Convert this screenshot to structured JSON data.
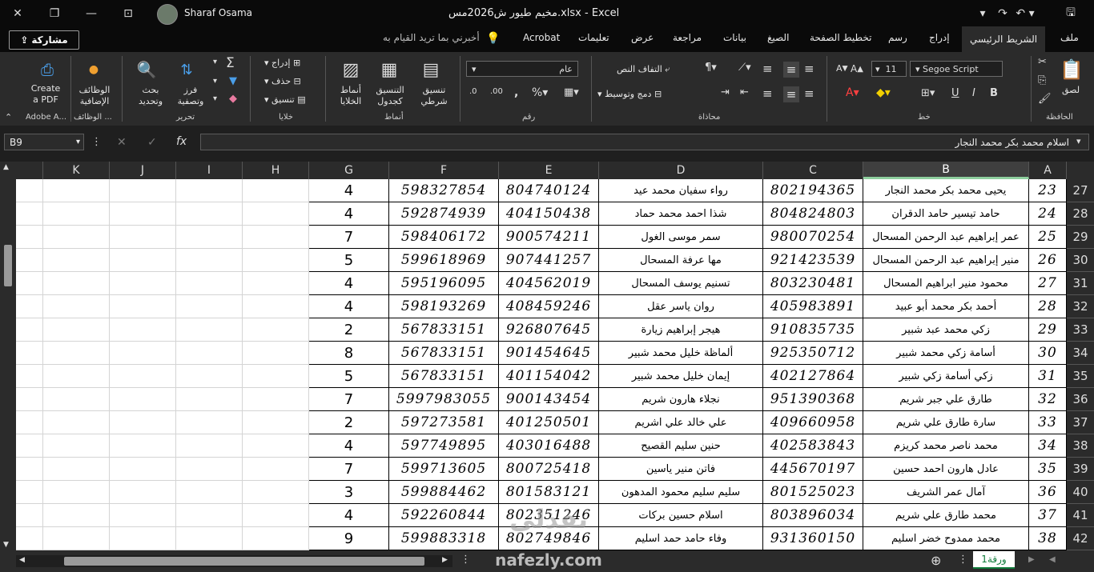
{
  "titlebar": {
    "user_name": "Sharaf Osama",
    "doc_title": "مخيم طيور ش2026مس.xlsx  -  Excel"
  },
  "share_label": "مشاركة",
  "tabs": [
    "ملف",
    "الشريط الرئيسي",
    "إدراج",
    "رسم",
    "تخطيط الصفحة",
    "الصيغ",
    "بيانات",
    "مراجعة",
    "عرض",
    "تعليمات",
    "Acrobat"
  ],
  "tell_me": "أخبرني بما تريد القيام به",
  "ribbon": {
    "clipboard": {
      "label": "الحافظة",
      "paste": "لصق"
    },
    "font": {
      "label": "خط",
      "font_name": "Segoe Script",
      "font_size": "11"
    },
    "alignment": {
      "label": "محاذاة",
      "wrap": "التفاف النص",
      "merge": "دمج وتوسيط"
    },
    "number": {
      "label": "رقم",
      "format": "عام"
    },
    "styles": {
      "label": "أنماط",
      "conditional": "تنسيق شرطي",
      "as_table": "التنسيق كجدول",
      "cell_styles": "أنماط الخلايا"
    },
    "cells": {
      "label": "خلايا",
      "insert": "إدراج",
      "delete": "حذف",
      "format": "تنسيق"
    },
    "editing": {
      "label": "تحرير",
      "sort": "فرز وتصفية",
      "find": "بحث وتحديد"
    },
    "addins": {
      "label": "الوظائف ...",
      "button": "الوظائف الإضافية"
    },
    "adobe": {
      "label": "Adobe A...",
      "button": "Create a PDF"
    }
  },
  "formula_bar": {
    "name_box": "B9",
    "content": "اسلام محمد بكر محمد النجار"
  },
  "columns": [
    "A",
    "B",
    "C",
    "D",
    "E",
    "F",
    "G",
    "H",
    "I",
    "J",
    "K"
  ],
  "rows": [
    {
      "row": "27",
      "a": "23",
      "b": "يحيى محمد بكر محمد النجار",
      "c": "802194365",
      "d": "رواء سفيان محمد عيد",
      "e": "804740124",
      "f": "598327854",
      "g": "4"
    },
    {
      "row": "28",
      "a": "24",
      "b": "حامد تيسير حامد الدقران",
      "c": "804824803",
      "d": "شذا احمد محمد حماد",
      "e": "404150438",
      "f": "592874939",
      "g": "4"
    },
    {
      "row": "29",
      "a": "25",
      "b": "عمر إبراهيم عبد الرحمن المسحال",
      "c": "980070254",
      "d": "سمر موسى الغول",
      "e": "900574211",
      "f": "598406172",
      "g": "7"
    },
    {
      "row": "30",
      "a": "26",
      "b": "منير إبراهيم عبد الرحمن المسحال",
      "c": "921423539",
      "d": "مها عرفة المسحال",
      "e": "907441257",
      "f": "599618969",
      "g": "5"
    },
    {
      "row": "31",
      "a": "27",
      "b": "محمود منير ابراهيم المسحال",
      "c": "803230481",
      "d": "تسنيم يوسف المسحال",
      "e": "404562019",
      "f": "595196095",
      "g": "4"
    },
    {
      "row": "32",
      "a": "28",
      "b": "أحمد بكر محمد أبو عبيد",
      "c": "405983891",
      "d": "روان ياسر عقل",
      "e": "408459246",
      "f": "598193269",
      "g": "4"
    },
    {
      "row": "33",
      "a": "29",
      "b": "زكي محمد عبد شبير",
      "c": "910835735",
      "d": "هيجر إبراهيم زيارة",
      "e": "926807645",
      "f": "567833151",
      "g": "2"
    },
    {
      "row": "34",
      "a": "30",
      "b": "أسامة زكي محمد شبير",
      "c": "925350712",
      "d": "ألماظة خليل محمد شبير",
      "e": "901454645",
      "f": "567833151",
      "g": "8"
    },
    {
      "row": "35",
      "a": "31",
      "b": "زكي أسامة زكي شبير",
      "c": "402127864",
      "d": "إيمان خليل محمد شبير",
      "e": "401154042",
      "f": "567833151",
      "g": "5"
    },
    {
      "row": "36",
      "a": "32",
      "b": "طارق علي جبر شريم",
      "c": "951390368",
      "d": "نجلاء هارون شريم",
      "e": "900143454",
      "f": "5997983055",
      "g": "7"
    },
    {
      "row": "37",
      "a": "33",
      "b": "سارة طارق علي شريم",
      "c": "409660958",
      "d": "علي خالد علي اشريم",
      "e": "401250501",
      "f": "597273581",
      "g": "2"
    },
    {
      "row": "38",
      "a": "34",
      "b": "محمد ناصر محمد كريزم",
      "c": "402583843",
      "d": "حنين سليم القصيح",
      "e": "403016488",
      "f": "597749895",
      "g": "4"
    },
    {
      "row": "39",
      "a": "35",
      "b": "عادل هارون احمد حسين",
      "c": "445670197",
      "d": "فاتن منير ياسين",
      "e": "800725418",
      "f": "599713605",
      "g": "7"
    },
    {
      "row": "40",
      "a": "36",
      "b": "آمال عمر الشريف",
      "c": "801525023",
      "d": "سليم سليم محمود المدهون",
      "e": "801583121",
      "f": "599884462",
      "g": "3"
    },
    {
      "row": "41",
      "a": "37",
      "b": "محمد طارق علي شريم",
      "c": "803896034",
      "d": "اسلام حسين بركات",
      "e": "802351246",
      "f": "592260844",
      "g": "4"
    },
    {
      "row": "42",
      "a": "38",
      "b": "محمد ممدوح خضر اسليم",
      "c": "931360150",
      "d": "وفاء حامد حمد اسليم",
      "e": "802749846",
      "f": "599883318",
      "g": "9"
    }
  ],
  "sheet_tab": "ورقة1",
  "watermark": "نفذلي",
  "watermark_url": "nafezly.com"
}
